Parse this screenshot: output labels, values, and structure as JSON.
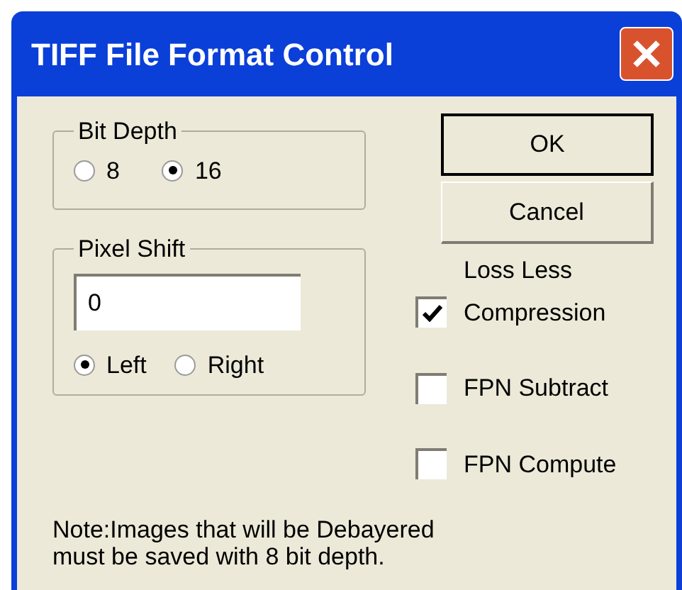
{
  "window": {
    "title": "TIFF File Format Control"
  },
  "bit_depth": {
    "label": "Bit Depth",
    "options": [
      {
        "label": "8",
        "selected": false
      },
      {
        "label": "16",
        "selected": true
      }
    ]
  },
  "pixel_shift": {
    "label": "Pixel Shift",
    "value": "0",
    "options": [
      {
        "label": "Left",
        "selected": true
      },
      {
        "label": "Right",
        "selected": false
      }
    ]
  },
  "buttons": [
    "OK",
    "Cancel"
  ],
  "compression_caption": "Loss Less",
  "checkboxes": [
    {
      "label": "Compression",
      "checked": true
    },
    {
      "label": "FPN Subtract",
      "checked": false
    },
    {
      "label": "FPN Compute",
      "checked": false
    }
  ],
  "note": "Note:Images that will be Debayered must be saved with 8 bit depth."
}
